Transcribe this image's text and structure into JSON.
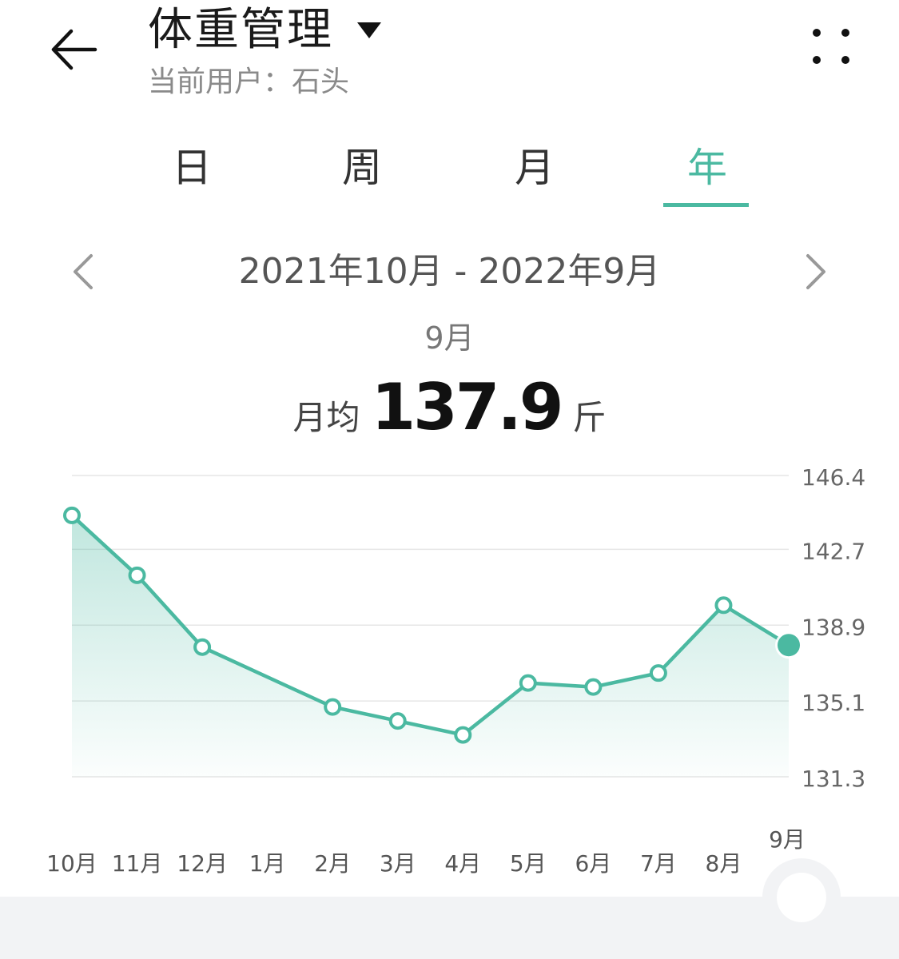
{
  "header": {
    "title": "体重管理",
    "subtitle": "当前用户：石头"
  },
  "tabs": [
    {
      "label": "日"
    },
    {
      "label": "周"
    },
    {
      "label": "月"
    },
    {
      "label": "年",
      "active": true
    }
  ],
  "range": {
    "text": "2021年10月 - 2022年9月"
  },
  "summary": {
    "month": "9月",
    "avg_label": "月均",
    "avg_value": "137.9",
    "unit": "斤"
  },
  "colors": {
    "accent": "#4bb9a1",
    "grid": "#e6e6e6"
  },
  "chart_data": {
    "type": "area",
    "categories": [
      "10月",
      "11月",
      "12月",
      "1月",
      "2月",
      "3月",
      "4月",
      "5月",
      "6月",
      "7月",
      "8月",
      "9月"
    ],
    "series": [
      {
        "values": [
          144.4,
          141.4,
          137.8,
          null,
          134.8,
          134.1,
          133.4,
          136.0,
          135.8,
          136.5,
          139.9,
          137.9
        ]
      }
    ],
    "yticks": [
      "146.4",
      "142.7",
      "138.9",
      "135.1",
      "131.3"
    ],
    "ylim": [
      131.3,
      146.4
    ],
    "highlight_index": 11,
    "grid": true
  }
}
